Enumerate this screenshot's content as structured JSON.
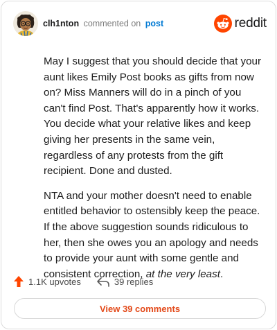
{
  "header": {
    "username": "clh1nton",
    "action": "commented on",
    "target": "post",
    "brand": "reddit",
    "avatar_icon": "cartoon-avatar-icon",
    "brand_icon": "reddit-alien-icon"
  },
  "comment": {
    "paragraph1": "May I suggest that you should decide that your aunt likes Emily Post books as gifts from now on? Miss Manners will do in a pinch of you can't find Post. That's apparently how it works. You decide what your relative likes and keep giving her presents in the same vein, regardless of any protests from the gift recipient. Done and dusted.",
    "paragraph2_main": "NTA and your mother doesn't need to enable entitled behavior to ostensibly keep the peace. If the above suggestion sounds ridiculous to her, then she owes you an apology and needs to provide your aunt with some gentle and consistent correction, ",
    "paragraph2_italic": "at the very least",
    "paragraph2_end": "."
  },
  "actions": {
    "upvotes": "1.1K upvotes",
    "replies": "39 replies",
    "upvote_icon": "upvote-arrow-icon",
    "reply_icon": "reply-arrow-icon"
  },
  "footer": {
    "view_comments": "View 39 comments"
  },
  "colors": {
    "accent": "#ff4500",
    "link": "#0079d3",
    "button_text": "#e34a1a"
  }
}
